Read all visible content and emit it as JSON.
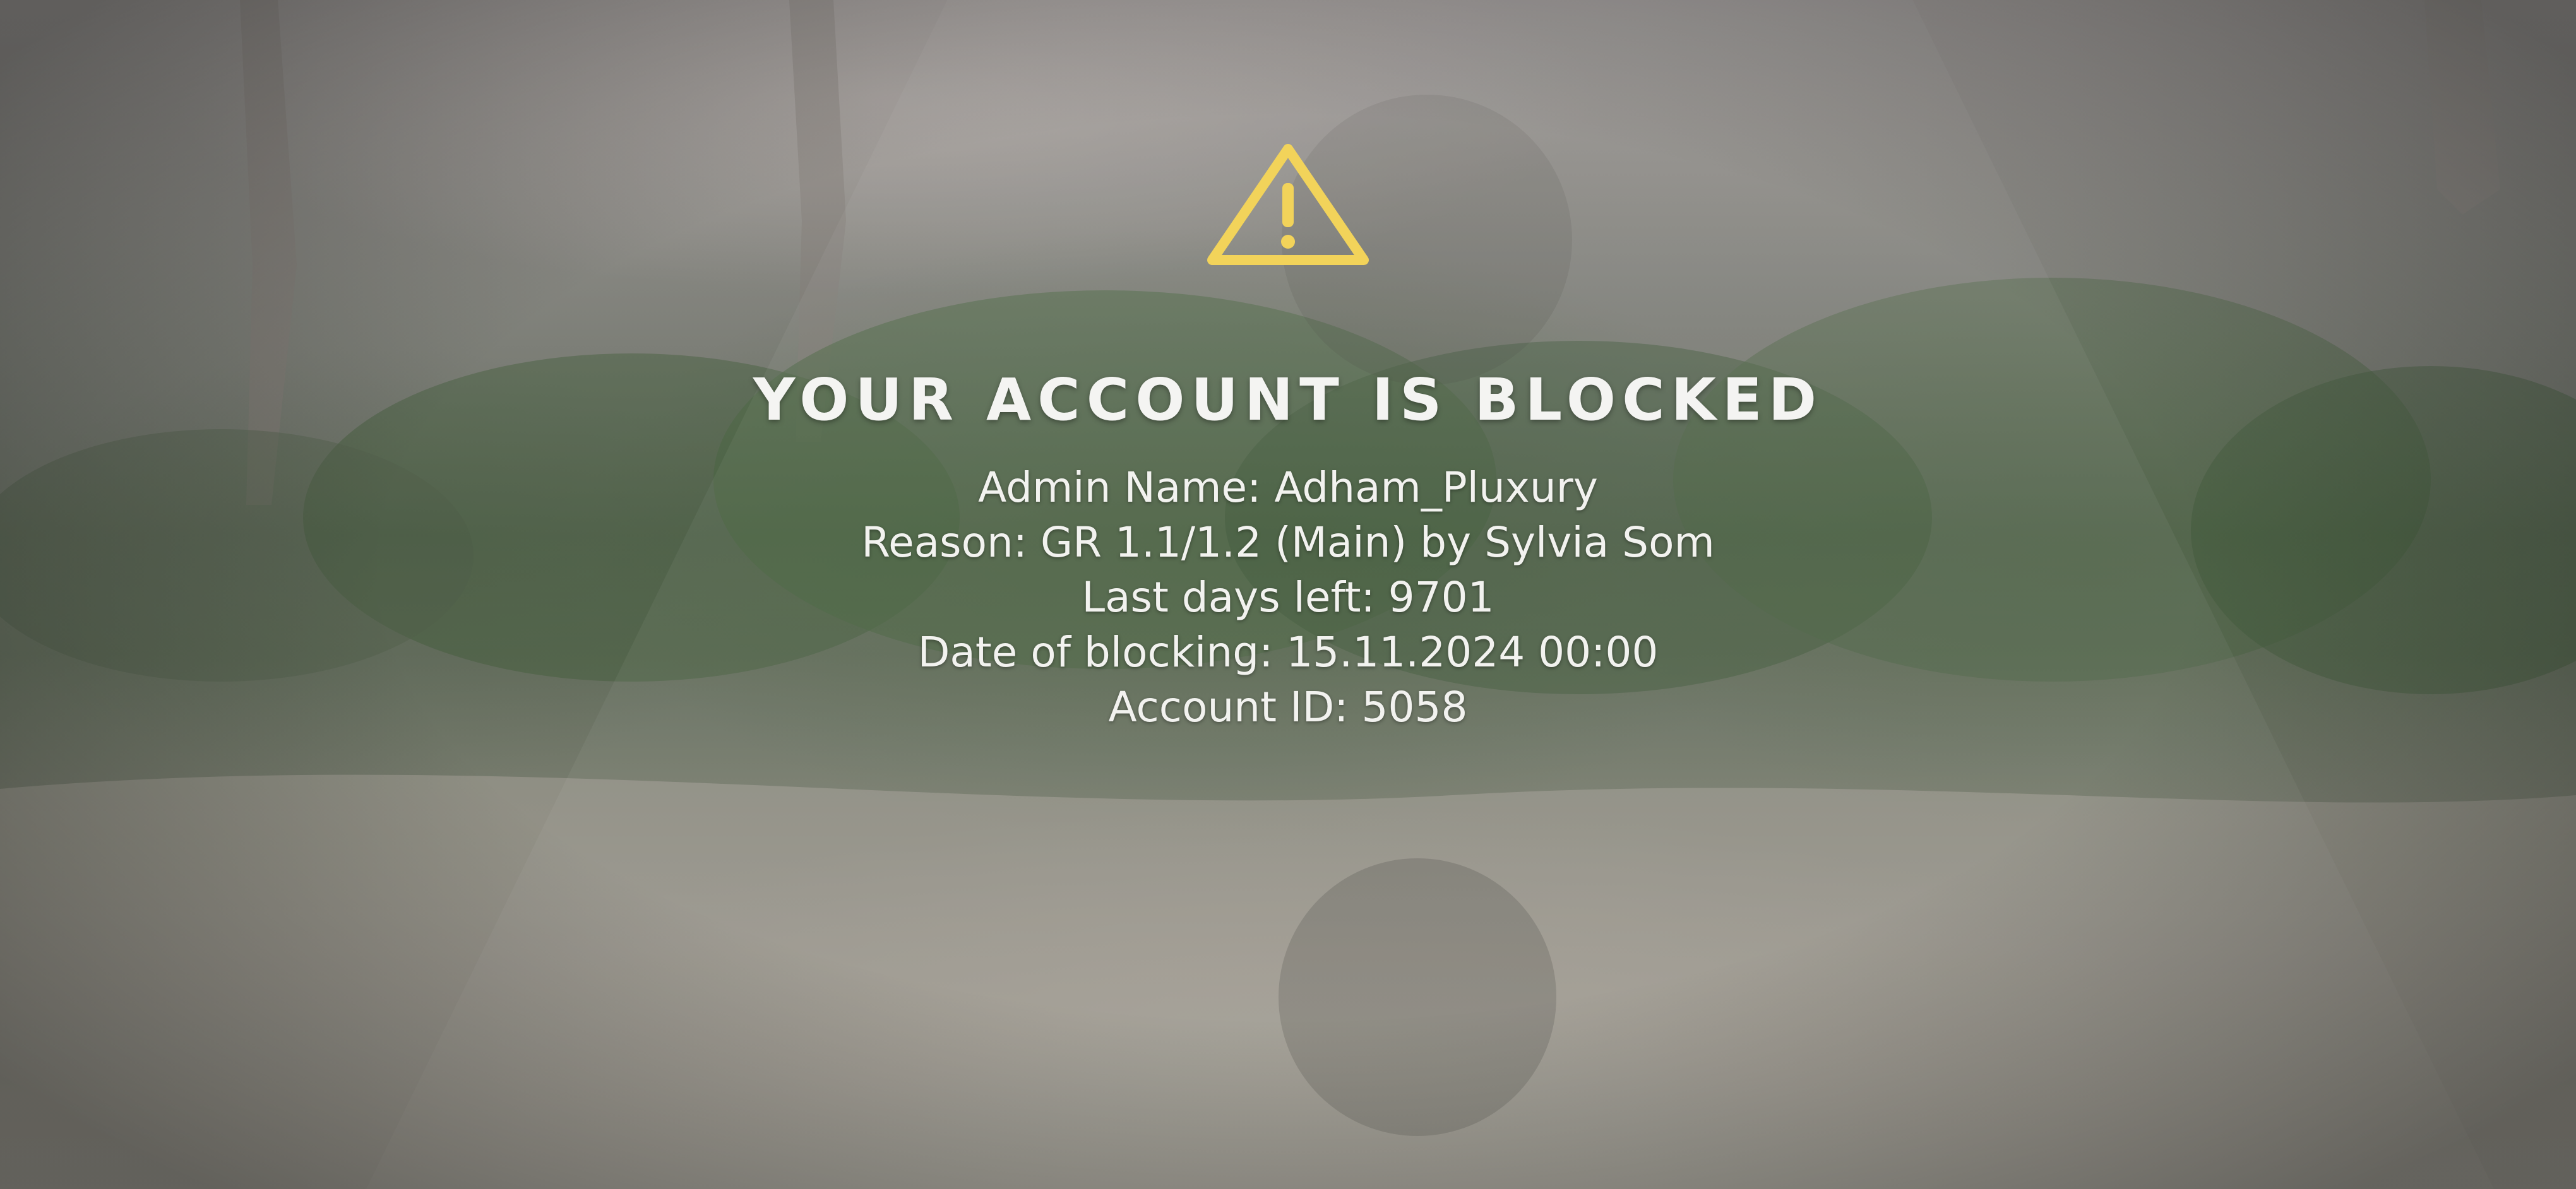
{
  "icon": "warning-triangle-icon",
  "accent_color": "#f2d35a",
  "title": "YOUR ACCOUNT IS BLOCKED",
  "details": [
    "Admin Name: Adham_Pluxury",
    "Reason: GR 1.1/1.2 (Main) by Sylvia Som",
    "Last days left: 9701",
    "Date of blocking: 15.11.2024 00:00",
    "Account ID: 5058"
  ]
}
